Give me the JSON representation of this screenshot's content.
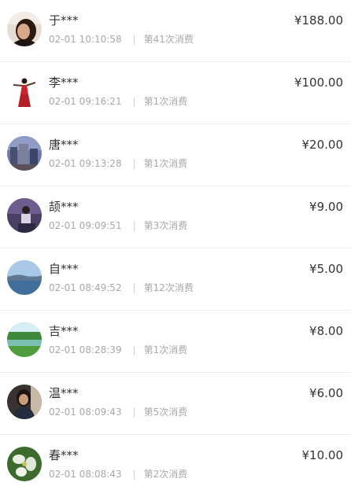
{
  "currency_symbol": "¥",
  "records": [
    {
      "name": "于***",
      "time": "02-01 10:10:58",
      "visit": "第41次消费",
      "amount": "188.00",
      "avatar_icon": "avatar-woman-portrait-icon"
    },
    {
      "name": "李***",
      "time": "02-01 09:16:21",
      "visit": "第1次消费",
      "amount": "100.00",
      "avatar_icon": "avatar-dancer-icon"
    },
    {
      "name": "唐***",
      "time": "02-01 09:13:28",
      "visit": "第1次消费",
      "amount": "20.00",
      "avatar_icon": "avatar-city-icon"
    },
    {
      "name": "颉***",
      "time": "02-01 09:09:51",
      "visit": "第3次消费",
      "amount": "9.00",
      "avatar_icon": "avatar-person-seated-icon"
    },
    {
      "name": "自***",
      "time": "02-01 08:49:52",
      "visit": "第12次消费",
      "amount": "5.00",
      "avatar_icon": "avatar-lake-landscape-icon"
    },
    {
      "name": "吉***",
      "time": "02-01 08:28:39",
      "visit": "第1次消费",
      "amount": "8.00",
      "avatar_icon": "avatar-green-field-icon"
    },
    {
      "name": "温***",
      "time": "02-01 08:09:43",
      "visit": "第5次消费",
      "amount": "6.00",
      "avatar_icon": "avatar-woman-dark-icon"
    },
    {
      "name": "春***",
      "time": "02-01 08:08:43",
      "visit": "第2次消费",
      "amount": "10.00",
      "avatar_icon": "avatar-flower-icon"
    }
  ]
}
